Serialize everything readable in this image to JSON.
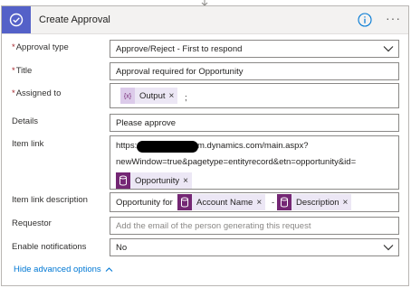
{
  "card": {
    "title": "Create Approval",
    "icon": "approval-check-icon",
    "info_icon": "info-icon",
    "more_icon": "more-options-icon",
    "accent_color": "#5461c8"
  },
  "fields": {
    "approval_type": {
      "label": "Approval type",
      "required": "*",
      "value": "Approve/Reject - First to respond"
    },
    "title": {
      "label": "Title",
      "required": "*",
      "value": "Approval required for Opportunity"
    },
    "assigned_to": {
      "label": "Assigned to",
      "required": "*",
      "token": "Output",
      "separator": ";"
    },
    "details": {
      "label": "Details",
      "value": "Please approve"
    },
    "item_link": {
      "label": "Item link",
      "line1_prefix": "https:",
      "line1_suffix": "m.dynamics.com/main.aspx?",
      "line2": "newWindow=true&pagetype=entityrecord&etn=opportunity&id=",
      "token": "Opportunity"
    },
    "item_link_description": {
      "label": "Item link description",
      "prefix": "Opportunity for",
      "token1": "Account Name",
      "separator": "-",
      "token2": "Description"
    },
    "requestor": {
      "label": "Requestor",
      "placeholder": "Add the email of the person generating this request"
    },
    "enable_notifications": {
      "label": "Enable notifications",
      "value": "No"
    }
  },
  "advanced_link": "Hide advanced options",
  "token_remove": "×"
}
